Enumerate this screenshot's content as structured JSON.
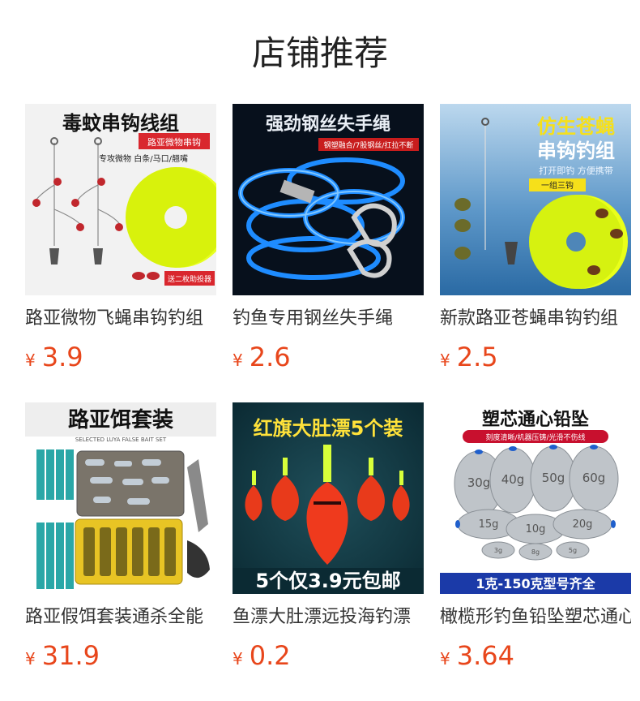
{
  "section": {
    "title": "店铺推荐"
  },
  "products": [
    {
      "name": "路亚微物飞蝇串钩钓组",
      "currency": "¥",
      "price": "3.9",
      "image": {
        "title": "毒蚊串钩线组",
        "tag": "路亚微物串钩",
        "line": "专攻微物 白条/马口/翘嘴",
        "badge": "送二枚助投器"
      }
    },
    {
      "name": "钓鱼专用钢丝失手绳",
      "currency": "¥",
      "price": "2.6",
      "image": {
        "title": "强劲钢丝失手绳",
        "tag": "钢塑融合/7股钢丝/扛拉不断"
      }
    },
    {
      "name": "新款路亚苍蝇串钩钓组",
      "currency": "¥",
      "price": "2.5",
      "image": {
        "title_line1": "仿生苍蝇",
        "title_line2": "串钩钓组",
        "tag": "打开即钓 方便携带",
        "badge": "一组三钩"
      }
    },
    {
      "name": "路亚假饵套装通杀全能",
      "currency": "¥",
      "price": "31.9",
      "image": {
        "title": "路亚饵套装",
        "subtitle": "SELECTED LUYA FALSE BAIT SET"
      }
    },
    {
      "name": "鱼漂大肚漂远投海钓漂",
      "currency": "¥",
      "price": "0.2",
      "image": {
        "title": "红旗大肚漂5个装",
        "banner": "5个仅3.9元包邮"
      }
    },
    {
      "name": "橄榄形钓鱼铅坠塑芯通心",
      "currency": "¥",
      "price": "3.64",
      "image": {
        "title": "塑芯通心铅坠",
        "tag": "刻度清晰/机器压铸/光滑不伤线",
        "w1": "30g",
        "w2": "40g",
        "w3": "50g",
        "w4": "60g",
        "w5": "15g",
        "w6": "10g",
        "w7": "20g",
        "w8": "3g",
        "w9": "8g",
        "w10": "5g",
        "banner": "1克-150克型号齐全"
      }
    }
  ]
}
